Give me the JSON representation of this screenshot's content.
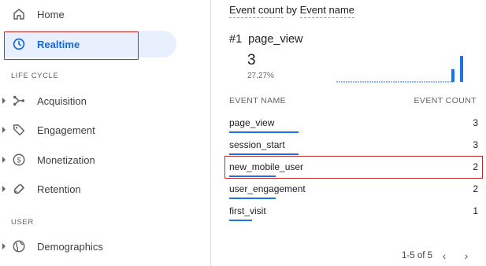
{
  "sidebar": {
    "home": "Home",
    "realtime": "Realtime",
    "life_cycle_title": "LIFE CYCLE",
    "acquisition": "Acquisition",
    "engagement": "Engagement",
    "monetization": "Monetization",
    "retention": "Retention",
    "user_title": "USER",
    "demographics": "Demographics"
  },
  "card": {
    "title_metric": "Event count",
    "title_by": "by",
    "title_dimension": "Event name",
    "top_rank": "#1",
    "top_event": "page_view",
    "top_value": "3",
    "top_pct": "27.27%",
    "col_event_name": "EVENT NAME",
    "col_event_count": "EVENT COUNT",
    "rows": [
      {
        "name": "page_view",
        "count": "3",
        "share": 1.0
      },
      {
        "name": "session_start",
        "count": "3",
        "share": 1.0
      },
      {
        "name": "new_mobile_user",
        "count": "2",
        "share": 0.67
      },
      {
        "name": "user_engagement",
        "count": "2",
        "share": 0.67
      },
      {
        "name": "first_visit",
        "count": "1",
        "share": 0.33
      }
    ],
    "pager_text": "1-5 of 5"
  },
  "colors": {
    "accent": "#1a73e8",
    "active_bg": "#e8f0fe",
    "highlight": "#c62828"
  }
}
